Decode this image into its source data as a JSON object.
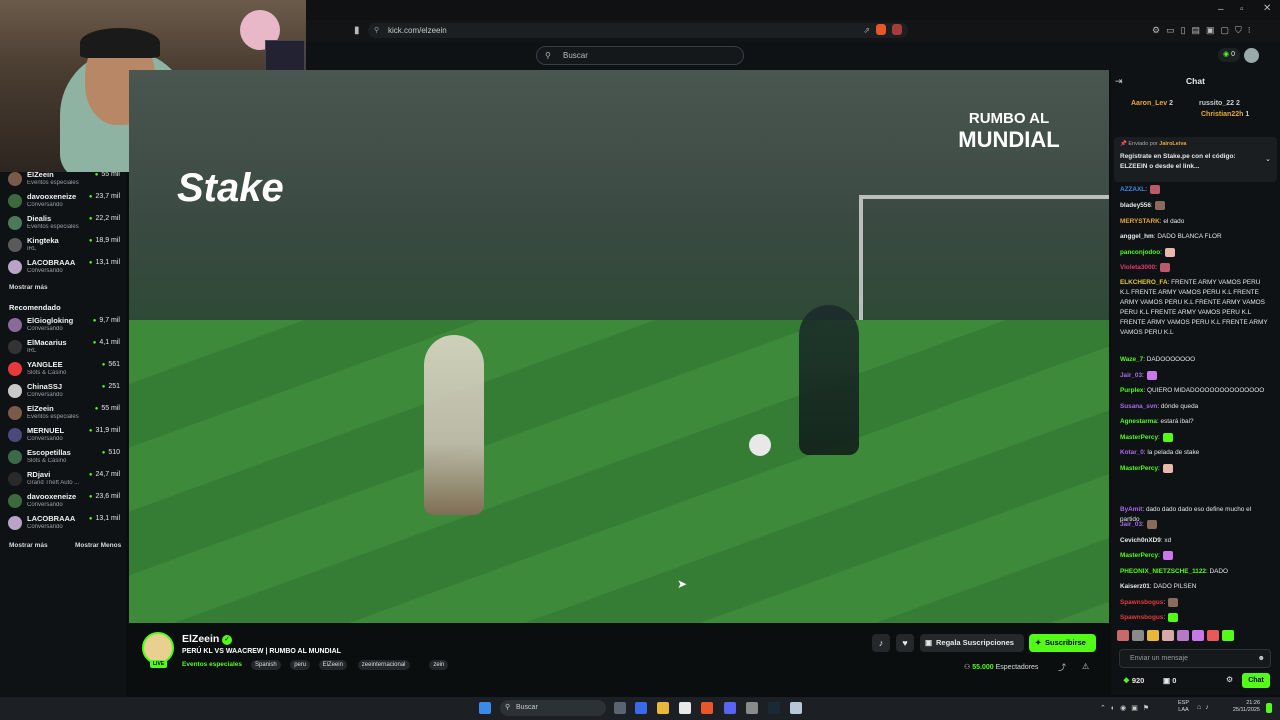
{
  "browser": {
    "url": "kick.com/elzeein"
  },
  "header": {
    "search_placeholder": "Buscar",
    "notif_count": "0"
  },
  "sidebar": {
    "following": [
      {
        "name": "ElZeein",
        "category": "Eventos especiales",
        "viewers": "55 mil",
        "color": "#7a5a4a"
      },
      {
        "name": "davooxeneize",
        "category": "Conversando",
        "viewers": "23,7 mil",
        "color": "#3c6a3c"
      },
      {
        "name": "Diealis",
        "category": "Eventos especiales",
        "viewers": "22,2 mil",
        "color": "#4a7a5a"
      },
      {
        "name": "Kingteka",
        "category": "IRL",
        "viewers": "18,9 mil",
        "color": "#5a5a5a"
      },
      {
        "name": "LACOBRAAA",
        "category": "Conversando",
        "viewers": "13,1 mil",
        "color": "#b9a3c8"
      }
    ],
    "show_more_1": "Mostrar más",
    "recommended_title": "Recomendado",
    "recommended": [
      {
        "name": "ElGiogloking",
        "category": "Conversando",
        "viewers": "9,7 mil",
        "color": "#8a6a9a"
      },
      {
        "name": "ElMacarius",
        "category": "IRL",
        "viewers": "4,1 mil",
        "color": "#333"
      },
      {
        "name": "YANGLEE",
        "category": "Slots & Casino",
        "viewers": "561",
        "color": "#e83a3a"
      },
      {
        "name": "ChinaSSJ",
        "category": "Conversando",
        "viewers": "251",
        "color": "#c9c9c9"
      },
      {
        "name": "ElZeein",
        "category": "Eventos especiales",
        "viewers": "55 mil",
        "color": "#7a5a4a"
      },
      {
        "name": "MERNUEL",
        "category": "Conversando",
        "viewers": "31,9 mil",
        "color": "#4a4a7a"
      },
      {
        "name": "Escopetillas",
        "category": "Slots & Casino",
        "viewers": "510",
        "color": "#3a6a4a"
      },
      {
        "name": "RDjavi",
        "category": "Grand Theft Auto ...",
        "viewers": "24,7 mil",
        "color": "#2a2a2a"
      },
      {
        "name": "davooxeneize",
        "category": "Conversando",
        "viewers": "23,6 mil",
        "color": "#3c6a3c"
      },
      {
        "name": "LACOBRAAA",
        "category": "Conversando",
        "viewers": "13,1 mil",
        "color": "#b9a3c8"
      }
    ],
    "show_more_2": "Mostrar más",
    "show_less": "Mostrar Menos"
  },
  "video": {
    "logo_left": "Stake",
    "logo_right_1": "RUMBO AL",
    "logo_right_2": "MUNDIAL"
  },
  "stream": {
    "channel": "ElZeein",
    "live_badge": "LIVE",
    "title": "PERÚ KL VS WAACREW | RUMBO AL MUNDIAL",
    "category": "Eventos especiales",
    "tags": [
      "Spanish",
      "peru",
      "ElZeein",
      "zeeinternacional",
      "zein"
    ],
    "gift_label": "Regala Suscripciones",
    "subscribe_label": "Suscribirse",
    "viewers": "55.000",
    "viewers_label": "Espectadores"
  },
  "chat": {
    "title": "Chat",
    "top_gifters": [
      {
        "name": "Aaron_Lev",
        "count": "2"
      },
      {
        "name": "russito_22",
        "count": "2"
      },
      {
        "name": "Christian22h",
        "count": "1"
      }
    ],
    "pinned_by_label": "Enviado por",
    "pinned_by_user": "JairoLeiva",
    "pinned_text": "Regístrate en Stake.pe con el código: ELZEEIN o desde el link...",
    "messages": [
      {
        "user": "AZZAXL",
        "text": "",
        "color": "#3a8ae8"
      },
      {
        "user": "bladey556",
        "text": "",
        "color": "#e8e8e8"
      },
      {
        "user": "MERYSTARK",
        "text": "el dado",
        "color": "#e8a83a"
      },
      {
        "user": "anggel_hm",
        "text": "DADO BLANCA FLOR",
        "color": "#e8e8e8"
      },
      {
        "user": "panconjodoo",
        "text": "",
        "color": "#53fc18"
      },
      {
        "user": "Violeta3000",
        "text": "",
        "color": "#e83a6a"
      },
      {
        "user": "ELKCHERO_FA",
        "text": "FRENTE ARMY VAMOS PERU K.L FRENTE ARMY VAMOS PERU K.L FRENTE ARMY VAMOS PERU K.L FRENTE ARMY VAMOS PERU K.L FRENTE ARMY VAMOS PERU K.L FRENTE ARMY VAMOS PERU K.L FRENTE ARMY VAMOS PERU K.L",
        "color": "#e8c83a"
      },
      {
        "user": "Waze_7",
        "text": "DADOOOOOOO",
        "color": "#53fc18"
      },
      {
        "user": "Jair_03",
        "text": "",
        "color": "#a86ae8"
      },
      {
        "user": "Purplex",
        "text": "QUIERO MIDADOOOOOOOOOOOOOO",
        "color": "#53fc18"
      },
      {
        "user": "Susana_svn",
        "text": "dónde queda",
        "color": "#a86ae8"
      },
      {
        "user": "Agnestarma",
        "text": "estará ibai?",
        "color": "#53fc18"
      },
      {
        "user": "MasterPercy",
        "text": "",
        "color": "#53fc18"
      },
      {
        "user": "Kotar_0",
        "text": "la pelada de stake",
        "color": "#a86ae8"
      },
      {
        "user": "MasterPercy",
        "text": "",
        "color": "#53fc18"
      },
      {
        "user": "ByAmit",
        "text": "dado dado dado eso define mucho el partido",
        "color": "#a86ae8"
      },
      {
        "user": "Jair_03",
        "text": "",
        "color": "#a86ae8"
      },
      {
        "user": "Cevich0nXD9",
        "text": "xd",
        "color": "#e8e8e8"
      },
      {
        "user": "MasterPercy",
        "text": "",
        "color": "#53fc18"
      },
      {
        "user": "PHEONIX_NIETZSCHE_1122",
        "text": "DADO",
        "color": "#53fc18"
      },
      {
        "user": "Kaiserz01",
        "text": "DADO PILSEN",
        "color": "#e8e8e8"
      },
      {
        "user": "Spawnsbogus",
        "text": "",
        "color": "#e83a3a"
      },
      {
        "user": "Spawnsbogus",
        "text": "",
        "color": "#e83a3a"
      },
      {
        "user": "Spawnsbogus",
        "text": "",
        "color": "#e83a3a"
      }
    ],
    "input_placeholder": "Enviar un mensaje",
    "points": "920",
    "gifts": "0",
    "send_label": "Chat"
  },
  "taskbar": {
    "search": "Buscar",
    "lang_1": "ESP",
    "lang_2": "LAA",
    "time": "21:26",
    "date": "25/11/2025"
  },
  "colors": {
    "accent": "#53fc18",
    "bg": "#0b0e0f",
    "panel": "#0f1214"
  }
}
